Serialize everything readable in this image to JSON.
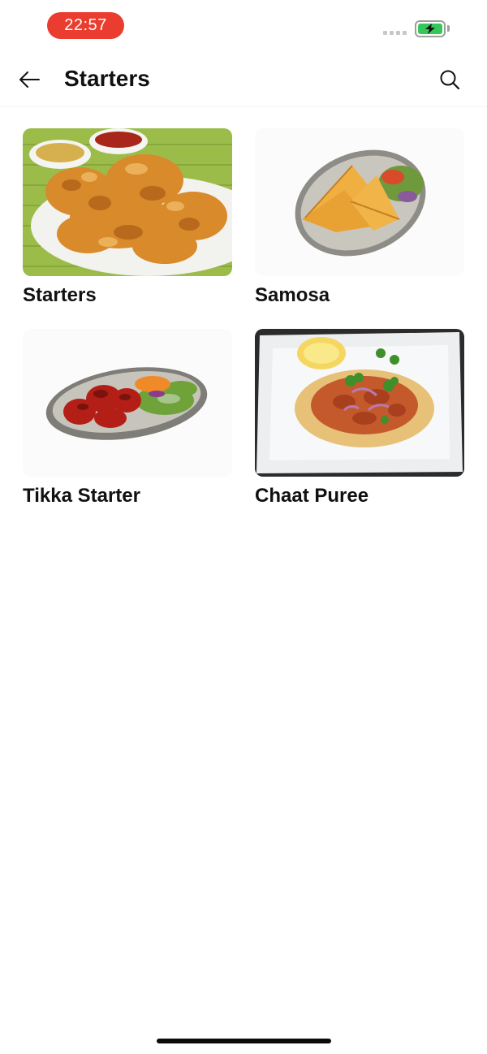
{
  "status_bar": {
    "time": "22:57",
    "time_pill_color": "#ea3d2f",
    "battery_color": "#34c759"
  },
  "header": {
    "title": "Starters",
    "back_icon": "arrow-left-icon",
    "search_icon": "search-icon"
  },
  "items": [
    {
      "label": "Starters",
      "image": "onion-bhaji-photo"
    },
    {
      "label": "Samosa",
      "image": "samosa-photo"
    },
    {
      "label": "Tikka Starter",
      "image": "tikka-photo"
    },
    {
      "label": "Chaat Puree",
      "image": "chaat-puree-photo"
    }
  ]
}
